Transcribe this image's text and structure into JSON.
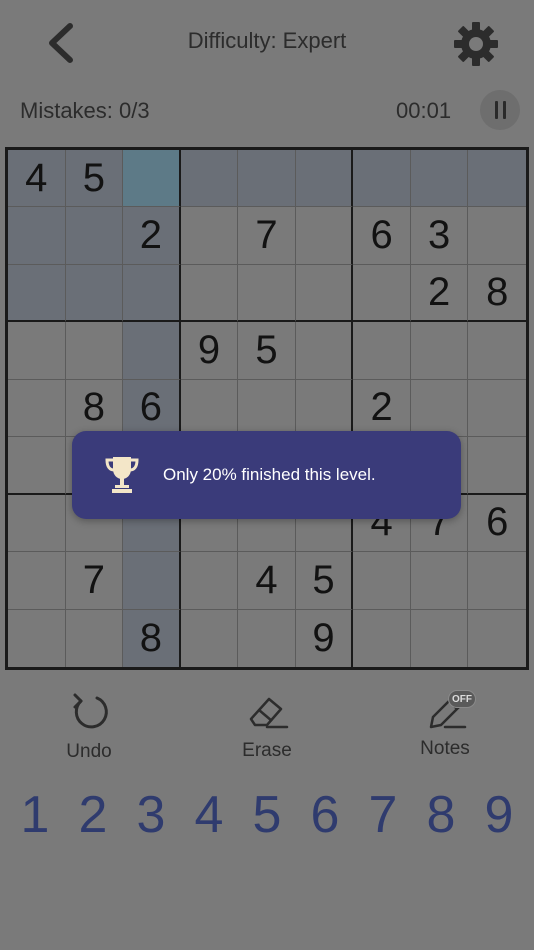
{
  "header": {
    "title": "Difficulty: Expert",
    "back_icon": "chevron-left-icon",
    "settings_icon": "gear-icon"
  },
  "status": {
    "mistakes": "Mistakes: 0/3",
    "timer": "00:01",
    "pause_icon": "pause-icon"
  },
  "board": {
    "cells": [
      [
        "4",
        "5",
        "",
        "",
        "",
        "",
        "",
        "",
        ""
      ],
      [
        "",
        "",
        "2",
        "",
        "7",
        "",
        "6",
        "3",
        ""
      ],
      [
        "",
        "",
        "",
        "",
        "",
        "",
        "",
        "2",
        "8"
      ],
      [
        "",
        "",
        "",
        "9",
        "5",
        "",
        "",
        "",
        ""
      ],
      [
        "",
        "8",
        "6",
        "",
        "",
        "",
        "2",
        "",
        ""
      ],
      [
        "",
        "",
        "",
        "",
        "",
        "",
        "",
        "",
        ""
      ],
      [
        "",
        "",
        "",
        "",
        "",
        "",
        "4",
        "7",
        "6"
      ],
      [
        "",
        "7",
        "",
        "",
        "4",
        "5",
        "",
        "",
        ""
      ],
      [
        "",
        "",
        "8",
        "",
        "",
        "9",
        "",
        "",
        ""
      ]
    ],
    "selected": [
      0,
      2
    ],
    "colors": {
      "highlight": "#6a6f77",
      "selected": "#5d7a87",
      "background": "#7a7a7a"
    }
  },
  "toast": {
    "icon": "trophy-icon",
    "message": "Only 20% finished this level.",
    "background": "#3a3b7a"
  },
  "tools": {
    "undo": {
      "label": "Undo",
      "icon": "undo-icon"
    },
    "erase": {
      "label": "Erase",
      "icon": "eraser-icon"
    },
    "notes": {
      "label": "Notes",
      "icon": "pencil-icon",
      "badge": "OFF"
    }
  },
  "numpad": [
    "1",
    "2",
    "3",
    "4",
    "5",
    "6",
    "7",
    "8",
    "9"
  ],
  "accent_color": "#2f3b6e"
}
